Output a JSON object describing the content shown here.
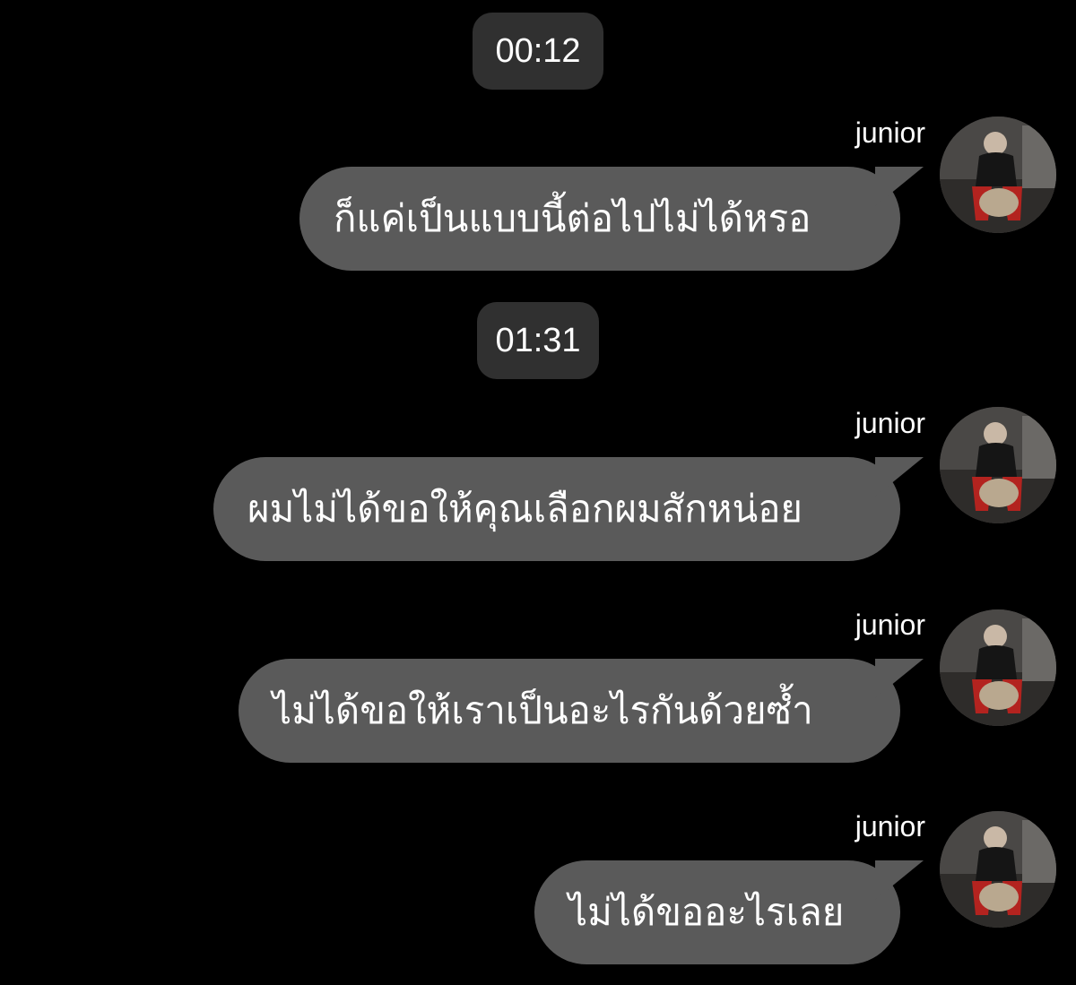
{
  "chat": {
    "timestamps": [
      "00:12",
      "01:31"
    ],
    "messages": [
      {
        "sender": "junior",
        "text": "ก็แค่เป็นแบบนี้ต่อไปไม่ได้หรอ",
        "avatar_icon": "user-avatar-icon"
      },
      {
        "sender": "junior",
        "text": "ผมไม่ได้ขอให้คุณเลือกผมสักหน่อย",
        "avatar_icon": "user-avatar-icon"
      },
      {
        "sender": "junior",
        "text": "ไม่ได้ขอให้เราเป็นอะไรกันด้วยซ้ำ",
        "avatar_icon": "user-avatar-icon"
      },
      {
        "sender": "junior",
        "text": "ไม่ได้ขออะไรเลย",
        "avatar_icon": "user-avatar-icon"
      }
    ]
  },
  "colors": {
    "background": "#000000",
    "bubble": "#5a5a5a",
    "timestamp_pill": "#303030",
    "text": "#ffffff"
  }
}
